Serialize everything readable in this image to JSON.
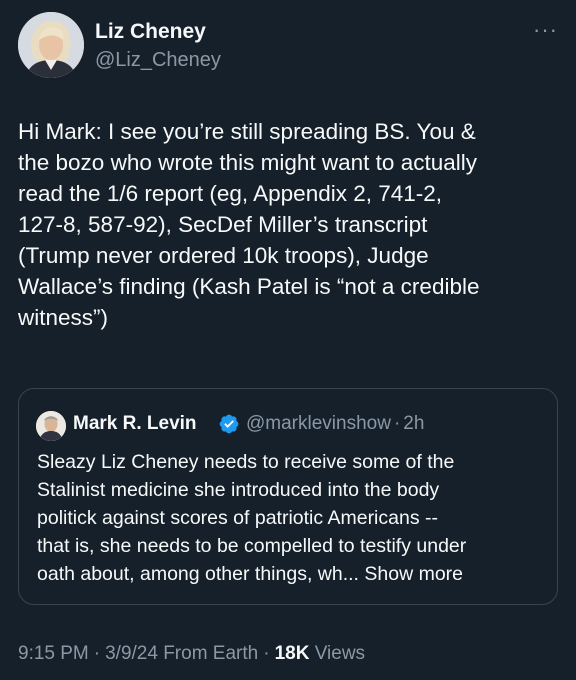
{
  "author": {
    "name": "Liz Cheney",
    "handle": "@Liz_Cheney"
  },
  "more_icon": "more-horizontal-icon",
  "tweet": {
    "lines": [
      "Hi Mark: I see you’re still spreading BS. You &",
      "the bozo who wrote this might want to actually",
      "read the 1/6 report (eg, Appendix 2, 741-2,",
      "127-8, 587-92), SecDef Miller’s transcript",
      "(Trump never ordered 10k troops), Judge",
      "Wallace’s finding (Kash Patel is “not a credible",
      "witness”)"
    ]
  },
  "quote": {
    "name": "Mark R. Levin",
    "verified_icon": "verified-badge-icon",
    "handle": "@marklevinshow",
    "separator": "·",
    "time": "2h",
    "lines": [
      "Sleazy Liz Cheney needs to receive some of the",
      "Stalinist medicine she introduced into the body",
      "politick  against scores of patriotic Americans --",
      "that is, she needs to be compelled to testify under",
      "oath about, among other things, wh..."
    ],
    "show_more": "Show more"
  },
  "meta": {
    "time": "9:15 PM",
    "date": "3/9/24",
    "source": "From Earth",
    "separator": "·",
    "views_count": "18K",
    "views_label": "Views"
  },
  "colors": {
    "background": "#15202b",
    "text": "#f7f9f9",
    "secondary": "#8b98a5",
    "border": "#38444d",
    "verified": "#1d9bf0"
  }
}
